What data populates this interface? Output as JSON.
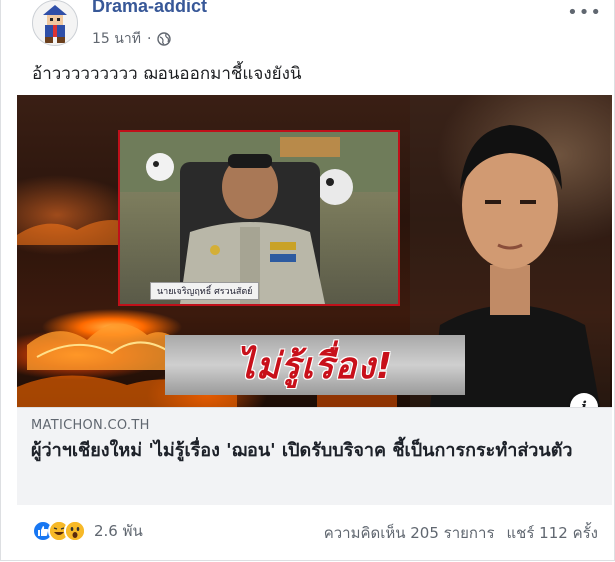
{
  "post": {
    "page_name": "Drama-addict",
    "time": "15 นาที",
    "separator": "·",
    "caption": "อ้าววววววววว ฌอนออกมาชี้แจงยังนิ"
  },
  "media": {
    "overlay_text": "ไม่รู้เรื่อง!",
    "nameplate": "นายเจริญฤทธิ์ ศรวนสัตย์"
  },
  "link": {
    "domain": "MATICHON.CO.TH",
    "title": "ผู้ว่าฯเชียงใหม่ 'ไม่รู้เรื่อง 'ฌอน' เปิดรับบริจาค ชี้เป็นการกระทำส่วนตัว"
  },
  "footer": {
    "reaction_count": "2.6 พัน",
    "comments": "ความคิดเห็น 205 รายการ",
    "shares": "แชร์ 112 ครั้ง"
  },
  "colors": {
    "page_name": "#385898",
    "headline_red": "#c8101a",
    "like_blue": "#1877f2"
  }
}
